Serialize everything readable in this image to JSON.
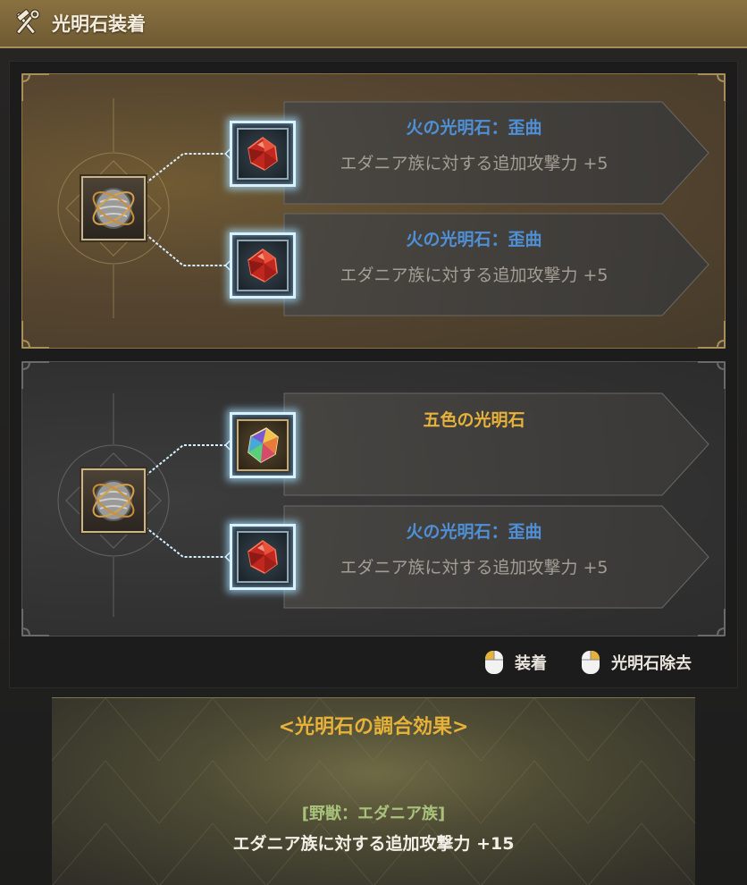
{
  "window": {
    "title": "光明石装着",
    "icon": "hammer-wrench-icon"
  },
  "sets": [
    {
      "slots": [
        {
          "gem": "fire-gem-icon",
          "name": "火の光明石：歪曲",
          "effect": "エダニア族に対する追加攻撃力 +5"
        },
        {
          "gem": "fire-gem-icon",
          "name": "火の光明石：歪曲",
          "effect": "エダニア族に対する追加攻撃力 +5"
        }
      ]
    },
    {
      "slots": [
        {
          "gem": "rainbow-gem-icon",
          "name": "五色の光明石",
          "effect": ""
        },
        {
          "gem": "fire-gem-icon",
          "name": "火の光明石：歪曲",
          "effect": "エダニア族に対する追加攻撃力 +5"
        }
      ]
    }
  ],
  "hints": {
    "equip": "装着",
    "remove": "光明石除去",
    "icon": "mouse-icon"
  },
  "harmony": {
    "title": "<光明石の調合効果>",
    "category": "[野獣：エダニア族]",
    "effect": "エダニア族に対する追加攻撃力 +15"
  },
  "colors": {
    "accent_gold": "#e6b23a",
    "gem_name_blue": "#4e8fd6",
    "selected_panel": "#6f5a33",
    "glow_blue": "#d9f1ff"
  }
}
